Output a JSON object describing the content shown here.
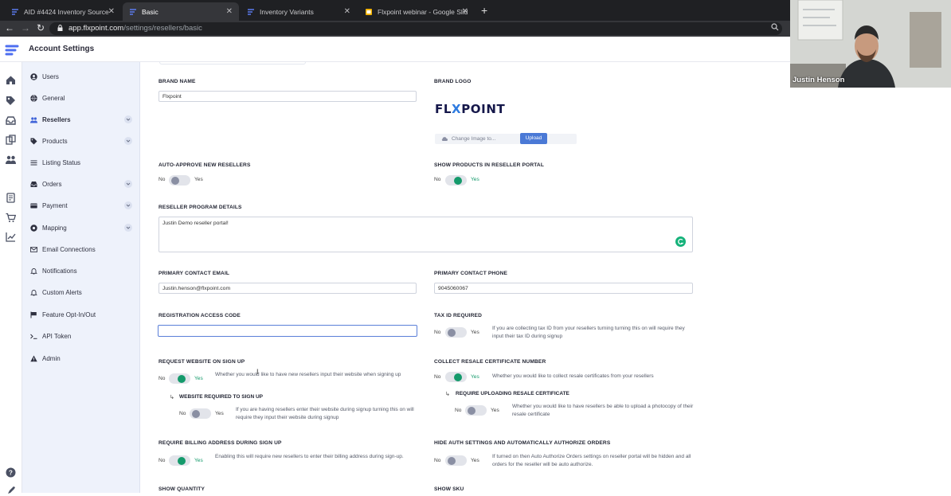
{
  "browser": {
    "tabs": [
      {
        "title": "AID #4424 Inventory Source",
        "active": false
      },
      {
        "title": "Basic",
        "active": true
      },
      {
        "title": "Inventory Variants",
        "active": false
      },
      {
        "title": "Flxpoint webinar - Google Slid",
        "active": false
      }
    ],
    "url_host": "app.flxpoint.com",
    "url_path": "/settings/resellers/basic"
  },
  "app": {
    "title": "Account Settings"
  },
  "subnav": [
    {
      "label": "Users",
      "icon": "user-circle-icon",
      "active": false,
      "expandable": false
    },
    {
      "label": "General",
      "icon": "globe-icon",
      "active": false,
      "expandable": false
    },
    {
      "label": "Resellers",
      "icon": "users-icon",
      "active": true,
      "expandable": true
    },
    {
      "label": "Products",
      "icon": "tag-icon",
      "active": false,
      "expandable": true
    },
    {
      "label": "Listing Status",
      "icon": "list-icon",
      "active": false,
      "expandable": false
    },
    {
      "label": "Orders",
      "icon": "inbox-icon",
      "active": false,
      "expandable": true
    },
    {
      "label": "Payment",
      "icon": "credit-card-icon",
      "active": false,
      "expandable": true
    },
    {
      "label": "Mapping",
      "icon": "map-pin-icon",
      "active": false,
      "expandable": true
    },
    {
      "label": "Email Connections",
      "icon": "envelope-icon",
      "active": false,
      "expandable": false
    },
    {
      "label": "Notifications",
      "icon": "bell-icon",
      "active": false,
      "expandable": false
    },
    {
      "label": "Custom Alerts",
      "icon": "alert-bell-icon",
      "active": false,
      "expandable": false
    },
    {
      "label": "Feature Opt-In/Out",
      "icon": "flag-icon",
      "active": false,
      "expandable": false
    },
    {
      "label": "API Token",
      "icon": "terminal-icon",
      "active": false,
      "expandable": false
    },
    {
      "label": "Admin",
      "icon": "warning-icon",
      "active": false,
      "expandable": false
    }
  ],
  "form": {
    "brand_name": {
      "label": "BRAND NAME",
      "value": "Flxpoint"
    },
    "brand_logo": {
      "label": "BRAND LOGO",
      "logo_text_a": "FL",
      "logo_text_x": "X",
      "logo_text_b": "POINT",
      "file_placeholder": "Change Image to...",
      "upload_label": "Upload"
    },
    "auto_approve": {
      "label": "AUTO-APPROVE NEW RESELLERS",
      "no": "No",
      "yes": "Yes",
      "on": false
    },
    "show_products": {
      "label": "SHOW PRODUCTS IN RESELLER PORTAL",
      "no": "No",
      "yes": "Yes",
      "on": true
    },
    "program_details": {
      "label": "RESELLER PROGRAM DETAILS",
      "value": "Justin Demo reseller portal!"
    },
    "contact_email": {
      "label": "PRIMARY CONTACT EMAIL",
      "value": "Justin.henson@flxpoint.com"
    },
    "contact_phone": {
      "label": "PRIMARY CONTACT PHONE",
      "value": "9045060067"
    },
    "access_code": {
      "label": "REGISTRATION ACCESS CODE",
      "value": ""
    },
    "tax_id": {
      "label": "TAX ID REQUIRED",
      "no": "No",
      "yes": "Yes",
      "on": false,
      "help": "If you are collecting tax ID from your resellers turning turning this on will require they input their tax ID during signup"
    },
    "request_website": {
      "label": "REQUEST WEBSITE ON SIGN UP",
      "no": "No",
      "yes": "Yes",
      "on": true,
      "help": "Whether you would like to have new resellers input their website when signing up"
    },
    "website_required": {
      "label": "WEBSITE REQUIRED TO SIGN UP",
      "no": "No",
      "yes": "Yes",
      "on": false,
      "help": "If you are having resellers enter their website during signup turning this on will require they input their website during signup"
    },
    "resale_cert": {
      "label": "COLLECT RESALE CERTIFICATE NUMBER",
      "no": "No",
      "yes": "Yes",
      "on": true,
      "help": "Whether you would like to collect resale certificates from your resellers"
    },
    "resale_upload": {
      "label": "REQUIRE UPLOADING RESALE CERTIFICATE",
      "no": "No",
      "yes": "Yes",
      "on": false,
      "help": "Whether you would like to have resellers be able to upload a photocopy of their resale certificate"
    },
    "billing_address": {
      "label": "REQUIRE BILLING ADDRESS DURING SIGN UP",
      "no": "No",
      "yes": "Yes",
      "on": true,
      "help": "Enabling this will require new resellers to enter their billing address during sign-up."
    },
    "hide_auth": {
      "label": "HIDE AUTH SETTINGS AND AUTOMATICALLY AUTHORIZE ORDERS",
      "no": "No",
      "yes": "Yes",
      "on": false,
      "help": "If turned on then Auto Authorize Orders settings on reseller portal will be hidden and all orders for the reseller will be auto authorize."
    },
    "show_quantity": {
      "label": "SHOW QUANTITY"
    },
    "show_sku": {
      "label": "SHOW SKU"
    }
  },
  "webcam": {
    "name": "Justin Henson"
  }
}
